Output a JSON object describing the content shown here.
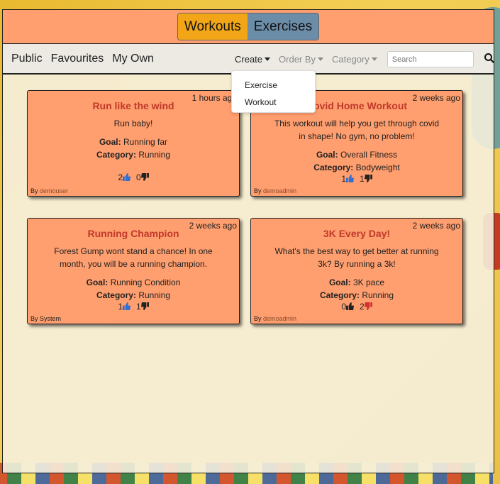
{
  "top_tabs": {
    "workouts": "Workouts",
    "exercises": "Exercises"
  },
  "nav": {
    "public": "Public",
    "favourites": "Favourites",
    "my_own": "My Own",
    "create": "Create",
    "order_by": "Order By",
    "category": "Category",
    "search_placeholder": "Search"
  },
  "create_menu": {
    "exercise": "Exercise",
    "workout": "Workout"
  },
  "cards": [
    {
      "time": "1 hours ago",
      "title": "Run like the wind",
      "description": "Run baby!",
      "goal_label": "Goal:",
      "goal": "Running far",
      "category_label": "Category:",
      "category": "Running",
      "likes": "2",
      "dislikes": "0",
      "by_label": "By",
      "author": "demouser"
    },
    {
      "time": "2 weeks ago",
      "title": "Covid Home Workout",
      "description": "This workout will help you get through covid in shape! No gym, no problem!",
      "goal_label": "Goal:",
      "goal": "Overall Fitness",
      "category_label": "Category:",
      "category": "Bodyweight",
      "likes": "1",
      "dislikes": "1",
      "by_label": "By",
      "author": "demoadmin"
    },
    {
      "time": "2 weeks ago",
      "title": "Running Champion",
      "description": "Forest Gump wont stand a chance! In one month, you will be a running champion.",
      "goal_label": "Goal:",
      "goal": "Running Condition",
      "category_label": "Category:",
      "category": "Running",
      "likes": "1",
      "dislikes": "1",
      "by_label": "By",
      "author": "System"
    },
    {
      "time": "2 weeks ago",
      "title": "3K Every Day!",
      "description": "What's the best way to get better at running 3k? By running a 3k!",
      "goal_label": "Goal:",
      "goal": "3K pace",
      "category_label": "Category:",
      "category": "Running",
      "likes": "0",
      "dislikes": "2",
      "by_label": "By",
      "author": "demoadmin"
    }
  ],
  "colors": {
    "accent_orange": "#ff9e6e",
    "active_tab": "#f2a617",
    "inactive_tab": "#6c8da8",
    "title_red": "#c0392b",
    "like_blue": "#2f6fd6",
    "dislike_red": "#d03030"
  }
}
